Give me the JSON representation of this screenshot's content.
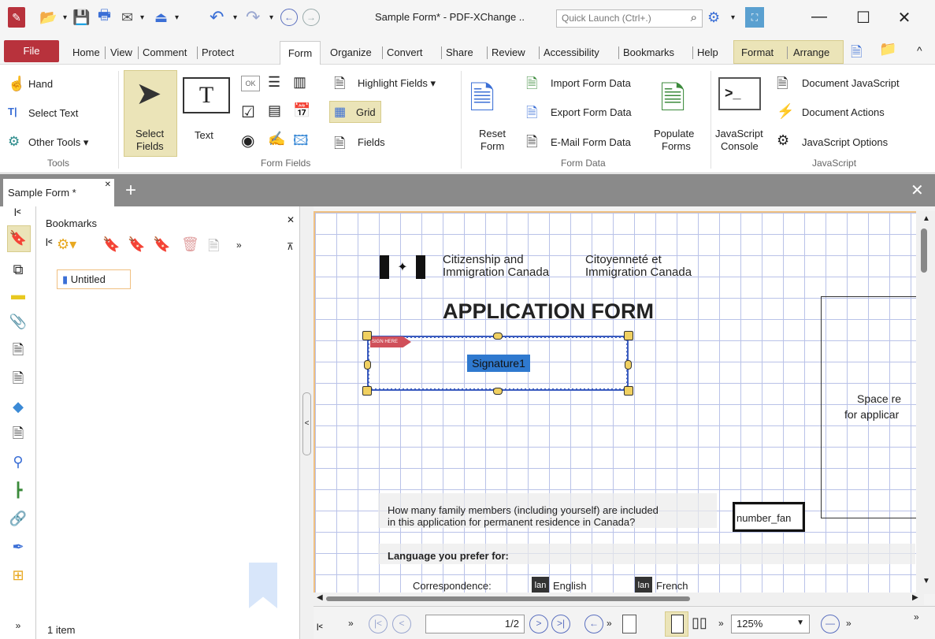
{
  "window": {
    "title": "Sample Form* - PDF-XChange ..",
    "quick_launch_placeholder": "Quick Launch (Ctrl+.)"
  },
  "menu": {
    "file": "File",
    "tabs": [
      "Home",
      "View",
      "Comment",
      "Protect",
      "Form",
      "Organize",
      "Convert",
      "Share",
      "Review",
      "Accessibility",
      "Bookmarks",
      "Help"
    ],
    "context_tabs": [
      "Format",
      "Arrange"
    ]
  },
  "ribbon": {
    "tools": {
      "hand": "Hand",
      "select_text": "Select Text",
      "other_tools": "Other Tools",
      "group": "Tools"
    },
    "form_fields": {
      "select_fields_1": "Select",
      "select_fields_2": "Fields",
      "text": "Text",
      "highlight_fields": "Highlight Fields",
      "grid": "Grid",
      "fields": "Fields",
      "group": "Form Fields",
      "ok": "OK"
    },
    "form_data": {
      "reset_1": "Reset",
      "reset_2": "Form",
      "import": "Import Form Data",
      "export": "Export Form Data",
      "email": "E-Mail Form Data",
      "populate_1": "Populate",
      "populate_2": "Forms",
      "group": "Form Data"
    },
    "javascript": {
      "console_1": "JavaScript",
      "console_2": "Console",
      "document_js": "Document JavaScript",
      "document_actions": "Document Actions",
      "js_options": "JavaScript Options",
      "group": "JavaScript"
    }
  },
  "doc_tab": {
    "label": "Sample Form *"
  },
  "bookmarks": {
    "title": "Bookmarks",
    "item": "Untitled",
    "count": "1 item"
  },
  "document": {
    "header_en_1": "Citizenship and",
    "header_en_2": "Immigration Canada",
    "header_fr_1": "Citoyenneté et",
    "header_fr_2": "Immigration Canada",
    "form_title": "APPLICATION FORM",
    "signature_field": "Signature1",
    "sign_tag": "SIGN HERE",
    "reserved_1": "Space re",
    "reserved_2": "for applicar",
    "family_q_1": "How many family members (including yourself) are included",
    "family_q_2": "in this application for permanent residence in Canada?",
    "number_field": "number_fan",
    "language": "Language you prefer for:",
    "correspondence": "Correspondence:",
    "lang_tag": "lan",
    "english": "English",
    "french": "French"
  },
  "status": {
    "page": "1/2",
    "zoom": "125%"
  }
}
